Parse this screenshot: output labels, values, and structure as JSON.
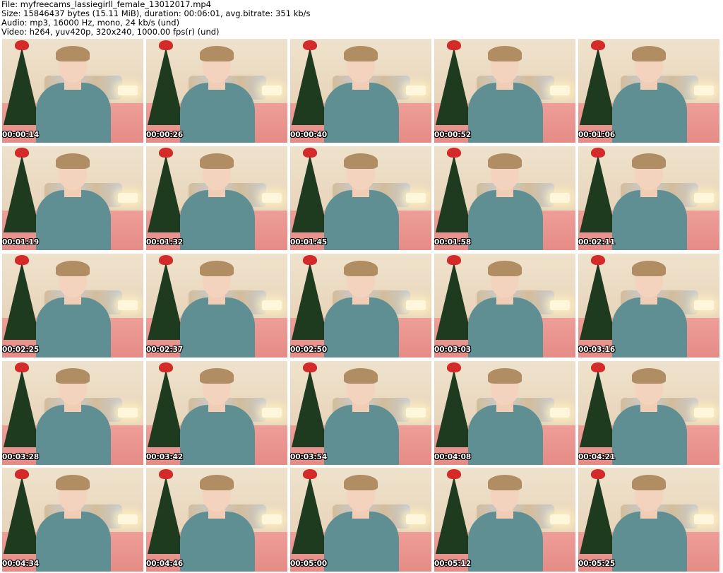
{
  "header": {
    "file_line": "File: myfreecams_lassiegirll_female_13012017.mp4",
    "size_line": "Size: 15846437 bytes (15.11 MiB), duration: 00:06:01, avg.bitrate: 351 kb/s",
    "audio_line": "Audio: mp3, 16000 Hz, mono, 24 kb/s (und)",
    "video_line": "Video: h264, yuv420p, 320x240, 1000.00 fps(r) (und)"
  },
  "frames": [
    {
      "timestamp": "00:00:14"
    },
    {
      "timestamp": "00:00:26"
    },
    {
      "timestamp": "00:00:40"
    },
    {
      "timestamp": "00:00:52"
    },
    {
      "timestamp": "00:01:06"
    },
    {
      "timestamp": "00:01:19"
    },
    {
      "timestamp": "00:01:32"
    },
    {
      "timestamp": "00:01:45"
    },
    {
      "timestamp": "00:01:58"
    },
    {
      "timestamp": "00:02:11"
    },
    {
      "timestamp": "00:02:25"
    },
    {
      "timestamp": "00:02:37"
    },
    {
      "timestamp": "00:02:50"
    },
    {
      "timestamp": "00:03:03"
    },
    {
      "timestamp": "00:03:16"
    },
    {
      "timestamp": "00:03:28"
    },
    {
      "timestamp": "00:03:42"
    },
    {
      "timestamp": "00:03:54"
    },
    {
      "timestamp": "00:04:08"
    },
    {
      "timestamp": "00:04:21"
    },
    {
      "timestamp": "00:04:34"
    },
    {
      "timestamp": "00:04:46"
    },
    {
      "timestamp": "00:05:00"
    },
    {
      "timestamp": "00:05:12"
    },
    {
      "timestamp": "00:05:25"
    }
  ]
}
